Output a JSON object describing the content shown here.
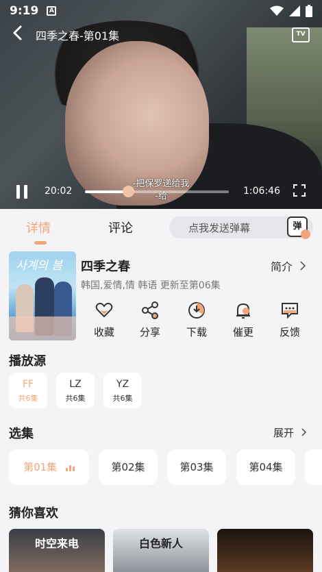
{
  "status_bar": {
    "time": "9:19",
    "notification_badge": "A"
  },
  "player": {
    "title": "四季之春-第01集",
    "tv_label": "TV",
    "current_time": "20:02",
    "duration": "1:06:46",
    "progress": 0.3,
    "subtitle_line1": "-把保罗递给我",
    "subtitle_line2": "-给"
  },
  "tabs": [
    {
      "label": "详情"
    },
    {
      "label": "评论"
    }
  ],
  "danmu": {
    "placeholder": "点我发送弹幕",
    "icon_char": "弹"
  },
  "show": {
    "title": "四季之春",
    "intro_label": "简介",
    "meta": "韩国,爱情,情 韩语 更新至第06集",
    "poster_text": "사계의 봄"
  },
  "actions": [
    {
      "label": "收藏",
      "icon": "heart-icon"
    },
    {
      "label": "分享",
      "icon": "share-icon"
    },
    {
      "label": "下载",
      "icon": "download-icon"
    },
    {
      "label": "催更",
      "icon": "bell-icon"
    },
    {
      "label": "反馈",
      "icon": "feedback-icon"
    }
  ],
  "sources_title": "播放源",
  "sources": [
    {
      "name": "FF",
      "count": "共6集"
    },
    {
      "name": "LZ",
      "count": "共6集"
    },
    {
      "name": "YZ",
      "count": "共6集"
    }
  ],
  "episodes_title": "选集",
  "expand_label": "展开",
  "episodes": [
    "第01集",
    "第02集",
    "第03集",
    "第04集"
  ],
  "recommend_title": "猜你喜欢",
  "recommendations": [
    {
      "title": "时空来电"
    },
    {
      "title": "白色新人"
    },
    {
      "title": ""
    }
  ],
  "colors": {
    "accent": "#f3a57a",
    "background": "#f4f4f6"
  }
}
